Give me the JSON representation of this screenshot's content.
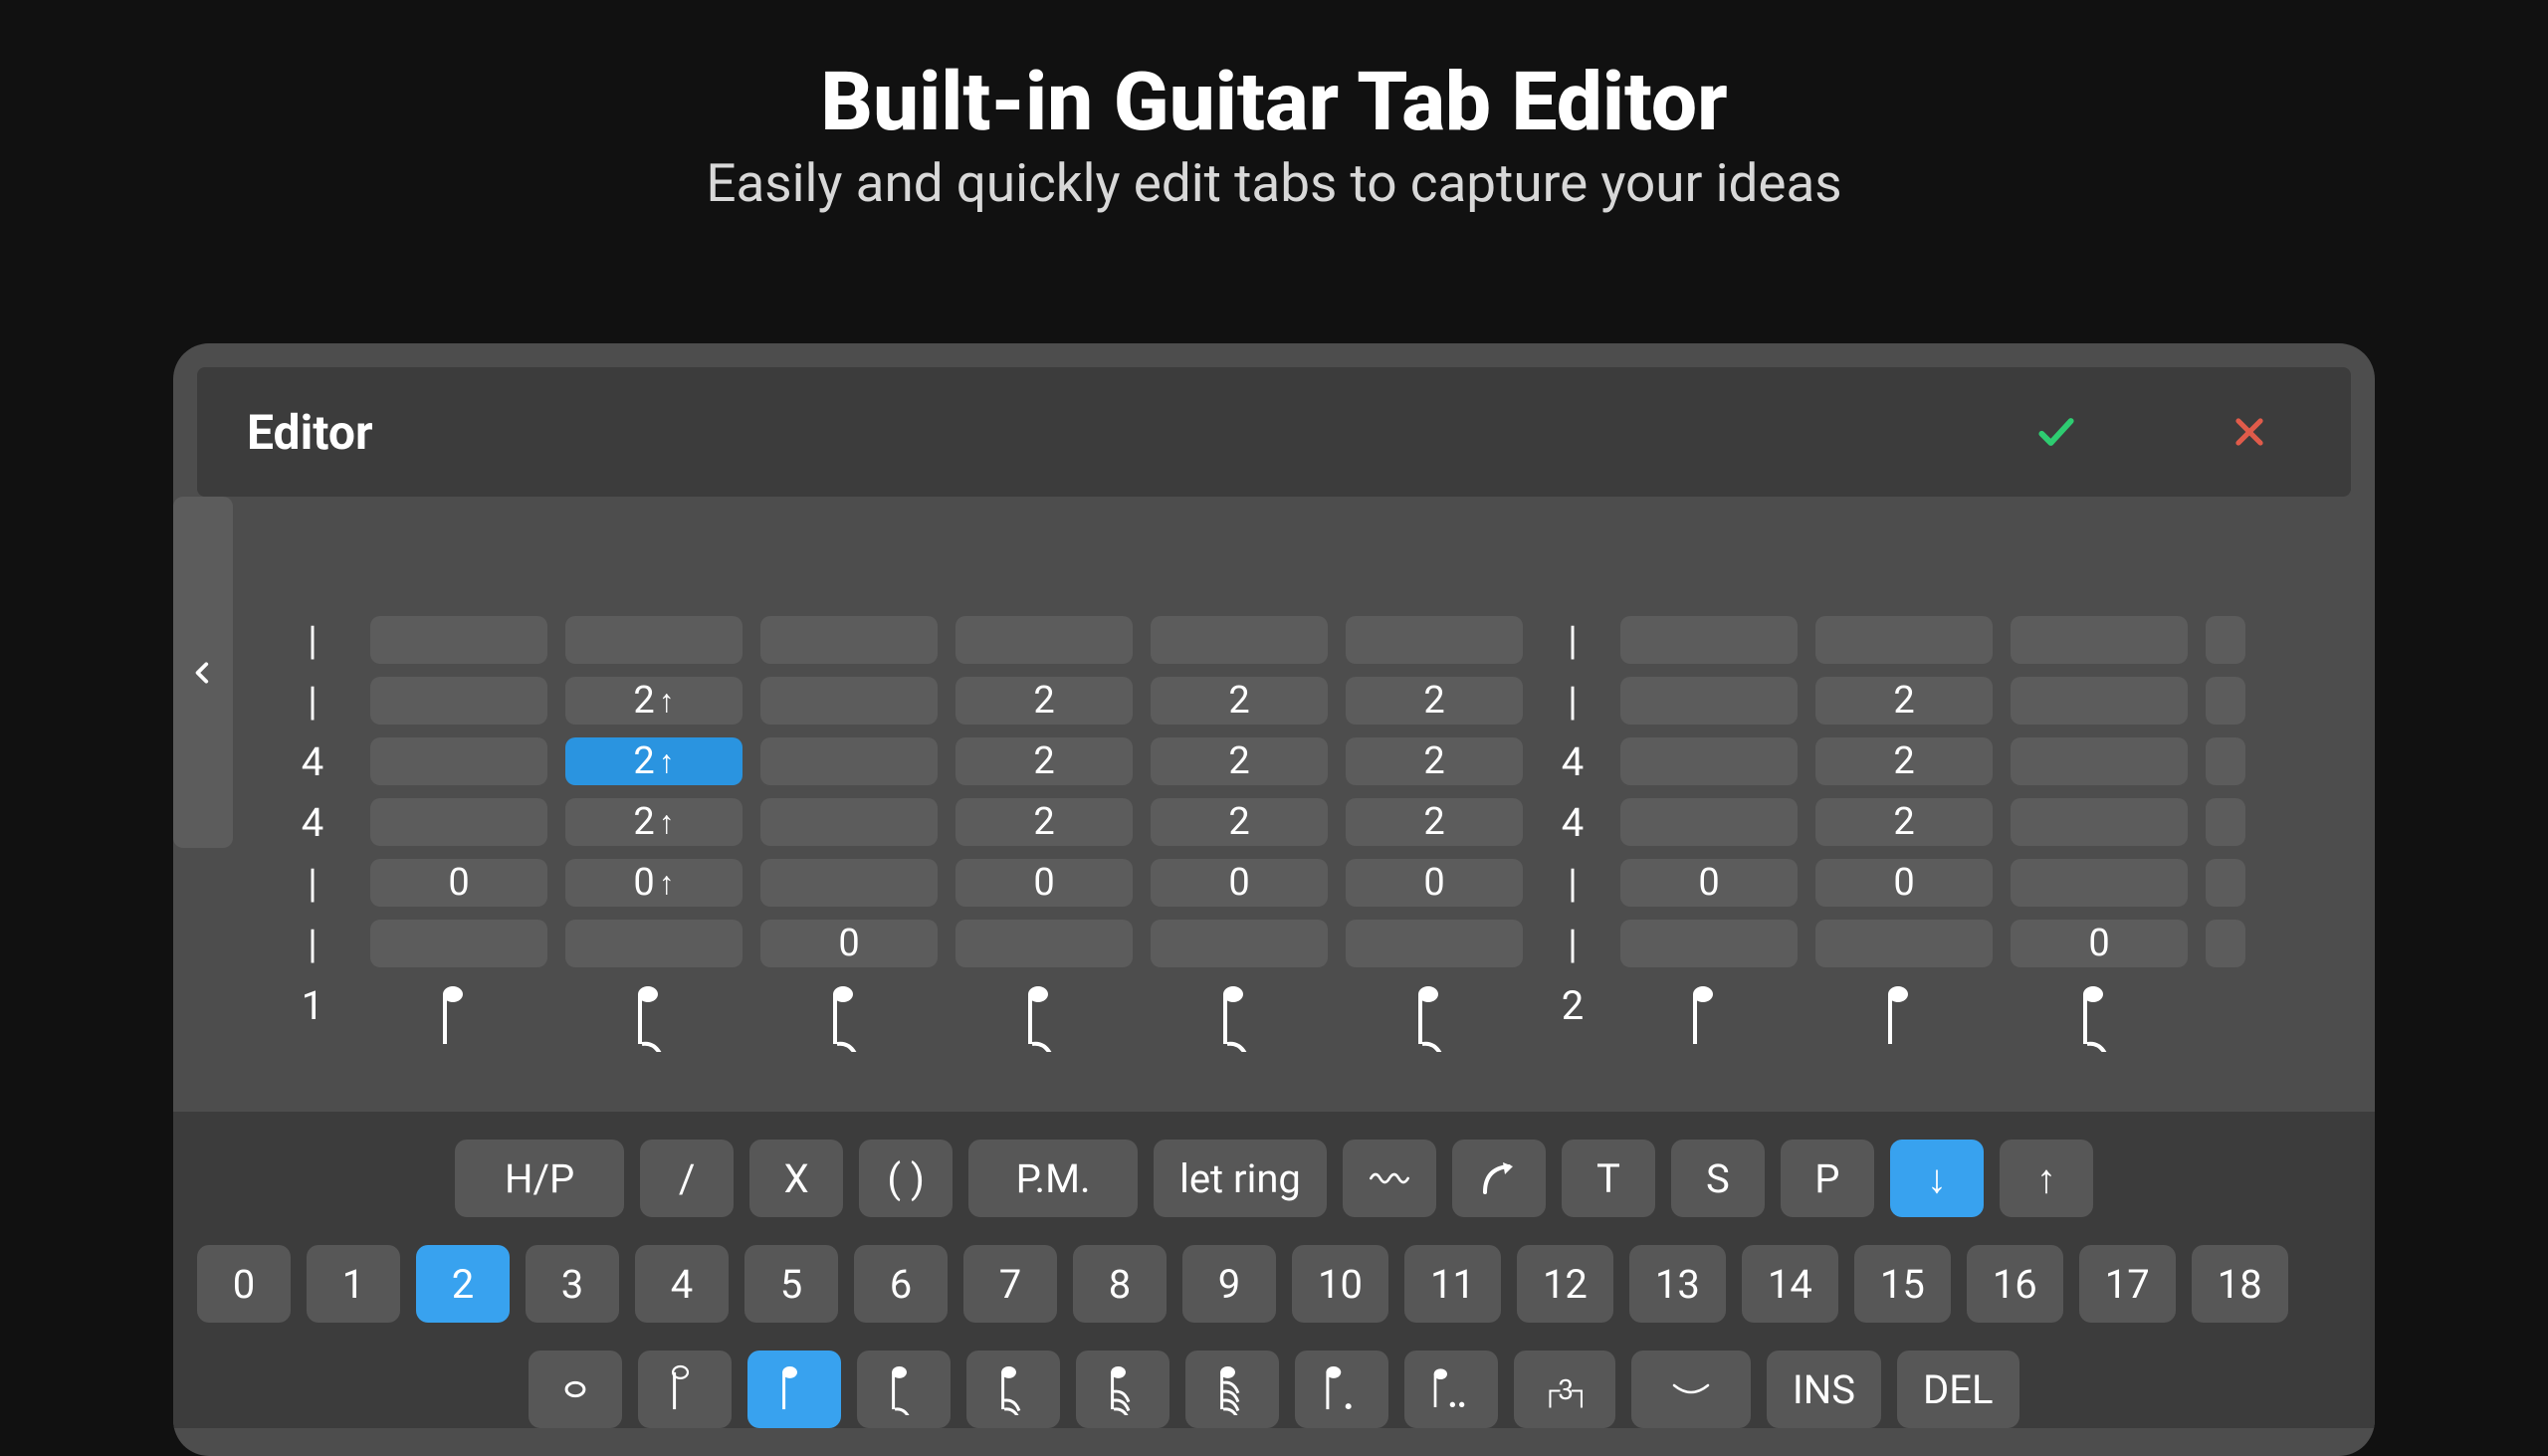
{
  "hero": {
    "title": "Built-in Guitar Tab Editor",
    "subtitle": "Easily and quickly edit tabs to capture your ideas"
  },
  "editor": {
    "title": "Editor",
    "meter": [
      "|",
      "|",
      "4",
      "4",
      "|",
      "|",
      "1"
    ],
    "meter2": [
      "|",
      "|",
      "4",
      "4",
      "|",
      "|",
      "2"
    ],
    "columns": [
      {
        "s1": "",
        "s2": "",
        "s3": "",
        "s4": "",
        "s5": "0",
        "s6": "",
        "dur": "quarter"
      },
      {
        "s1": "",
        "s2": "2↑",
        "s3": "2↑",
        "s4": "2↑",
        "s5": "0↑",
        "s6": "",
        "dur": "eighth",
        "selectedString": 3
      },
      {
        "s1": "",
        "s2": "",
        "s3": "",
        "s4": "",
        "s5": "",
        "s6": "0",
        "dur": "eighth"
      },
      {
        "s1": "",
        "s2": "2",
        "s3": "2",
        "s4": "2",
        "s5": "0",
        "s6": "",
        "dur": "eighth"
      },
      {
        "s1": "",
        "s2": "2",
        "s3": "2",
        "s4": "2",
        "s5": "0",
        "s6": "",
        "dur": "eighth"
      },
      {
        "s1": "",
        "s2": "2",
        "s3": "2",
        "s4": "2",
        "s5": "0",
        "s6": "",
        "dur": "eighth"
      }
    ],
    "columns2": [
      {
        "s1": "",
        "s2": "",
        "s3": "",
        "s4": "",
        "s5": "0",
        "s6": "",
        "dur": "quarter"
      },
      {
        "s1": "",
        "s2": "2",
        "s3": "2",
        "s4": "2",
        "s5": "0",
        "s6": "",
        "dur": "quarter"
      },
      {
        "s1": "",
        "s2": "",
        "s3": "",
        "s4": "",
        "s5": "",
        "s6": "0",
        "dur": "eighth"
      }
    ],
    "toolbar": {
      "techniques": [
        {
          "label": "H/P",
          "sel": false
        },
        {
          "label": "/",
          "sel": false
        },
        {
          "label": "X",
          "sel": false
        },
        {
          "label": "( )",
          "sel": false
        },
        {
          "label": "P.M.",
          "sel": false
        },
        {
          "label": "let ring",
          "sel": false
        },
        {
          "label": "~",
          "sel": false,
          "icon": "vibrato"
        },
        {
          "label": "↗",
          "sel": false,
          "icon": "bend"
        },
        {
          "label": "T",
          "sel": false
        },
        {
          "label": "S",
          "sel": false
        },
        {
          "label": "P",
          "sel": false
        },
        {
          "label": "↓",
          "sel": true
        },
        {
          "label": "↑",
          "sel": false
        }
      ],
      "frets": [
        "0",
        "1",
        "2",
        "3",
        "4",
        "5",
        "6",
        "7",
        "8",
        "9",
        "10",
        "11",
        "12",
        "13",
        "14",
        "15",
        "16",
        "17",
        "18"
      ],
      "fret_selected": 2,
      "durations": [
        {
          "n": "whole"
        },
        {
          "n": "half"
        },
        {
          "n": "quarter",
          "sel": true
        },
        {
          "n": "eighth"
        },
        {
          "n": "sixteenth"
        },
        {
          "n": "thirtysecond"
        },
        {
          "n": "sixtyfourth"
        },
        {
          "n": "dot"
        },
        {
          "n": "dotdot"
        },
        {
          "n": "tuplet",
          "label": "┌3┐"
        },
        {
          "n": "tie"
        },
        {
          "n": "ins",
          "label": "INS"
        },
        {
          "n": "del",
          "label": "DEL"
        }
      ]
    }
  }
}
